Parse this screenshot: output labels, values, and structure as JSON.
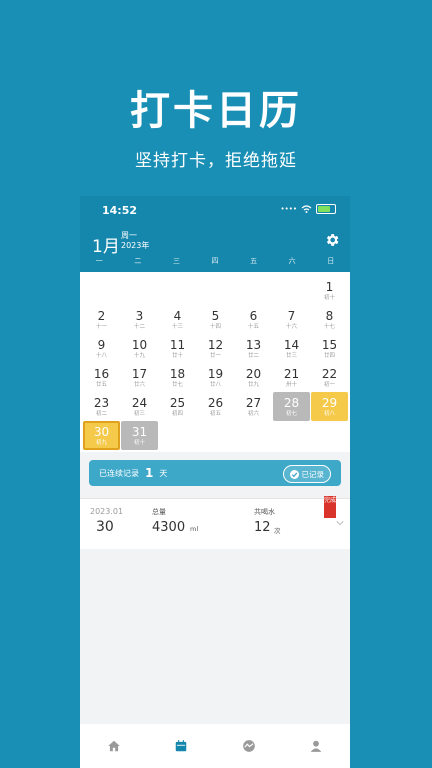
{
  "promo": {
    "title": "打卡日历",
    "subtitle": "坚持打卡，拒绝拖延"
  },
  "status": {
    "time": "14:52"
  },
  "header": {
    "month": "1月",
    "weekday": "周一",
    "year": "2023年"
  },
  "weekdays": [
    "一",
    "二",
    "三",
    "四",
    "五",
    "六",
    "日"
  ],
  "calendar": {
    "leading_blanks": 6,
    "days": [
      {
        "d": "1",
        "l": "初十"
      },
      {
        "d": "2",
        "l": "十一"
      },
      {
        "d": "3",
        "l": "十二"
      },
      {
        "d": "4",
        "l": "十三"
      },
      {
        "d": "5",
        "l": "十四"
      },
      {
        "d": "6",
        "l": "十五"
      },
      {
        "d": "7",
        "l": "十六"
      },
      {
        "d": "8",
        "l": "十七"
      },
      {
        "d": "9",
        "l": "十八"
      },
      {
        "d": "10",
        "l": "十九"
      },
      {
        "d": "11",
        "l": "廿十"
      },
      {
        "d": "12",
        "l": "廿一"
      },
      {
        "d": "13",
        "l": "廿二"
      },
      {
        "d": "14",
        "l": "廿三"
      },
      {
        "d": "15",
        "l": "廿四"
      },
      {
        "d": "16",
        "l": "廿五"
      },
      {
        "d": "17",
        "l": "廿六"
      },
      {
        "d": "18",
        "l": "廿七"
      },
      {
        "d": "19",
        "l": "廿八"
      },
      {
        "d": "20",
        "l": "廿九"
      },
      {
        "d": "21",
        "l": "卅十"
      },
      {
        "d": "22",
        "l": "初一"
      },
      {
        "d": "23",
        "l": "初二"
      },
      {
        "d": "24",
        "l": "初三"
      },
      {
        "d": "25",
        "l": "初四"
      },
      {
        "d": "26",
        "l": "初五"
      },
      {
        "d": "27",
        "l": "初六"
      },
      {
        "d": "28",
        "l": "初七",
        "state": "gray"
      },
      {
        "d": "29",
        "l": "初八",
        "state": "gold"
      },
      {
        "d": "30",
        "l": "初九",
        "state": "gold-selected"
      },
      {
        "d": "31",
        "l": "初十",
        "state": "gray"
      }
    ]
  },
  "streak": {
    "prefix": "已连续记录",
    "count": "1",
    "suffix": "天",
    "button": "已记录"
  },
  "record": {
    "date": "2023.01",
    "day": "30",
    "label_total": "总量",
    "total": "4300",
    "total_unit": "ml",
    "label_count": "共喝水",
    "count": "12",
    "count_unit": "次",
    "badge": "完成"
  },
  "tabs": [
    "home-icon",
    "calendar-icon",
    "stats-icon",
    "profile-icon"
  ],
  "colors": {
    "primary": "#1687ac",
    "background": "#1a8fb5",
    "gold": "#f5c94a",
    "gray": "#b9b9b9",
    "active_tab": "#1687ac"
  }
}
